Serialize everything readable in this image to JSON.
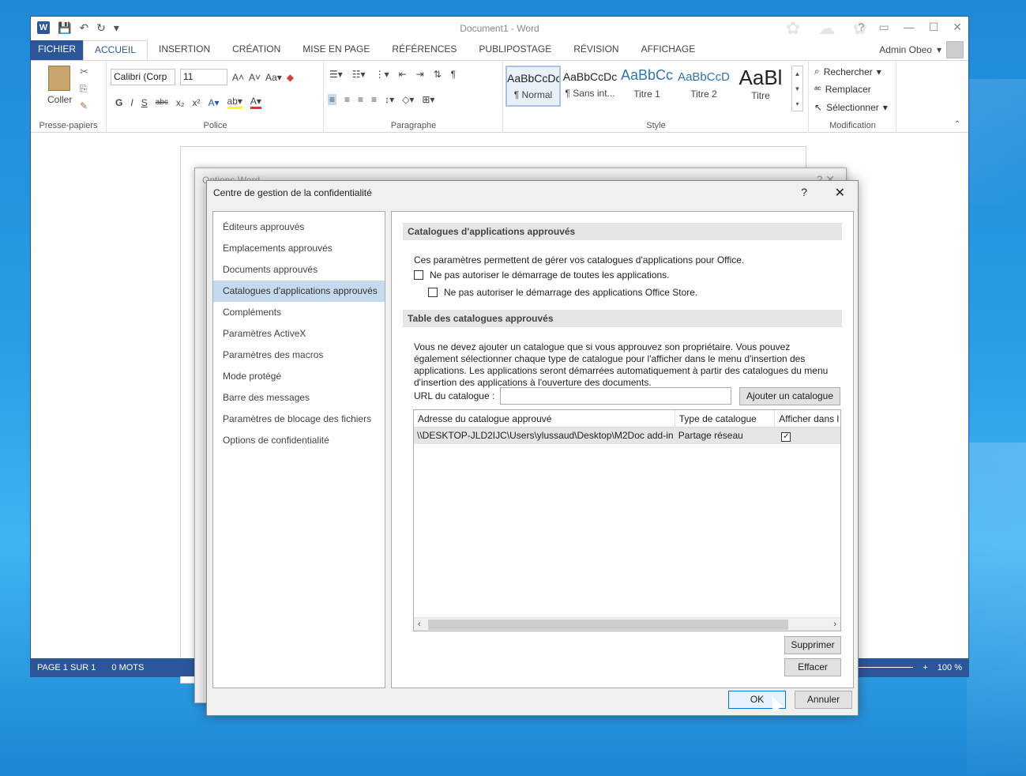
{
  "word": {
    "title": "Document1 - Word",
    "qat_icons": [
      "word-logo-icon",
      "save-icon",
      "undo-icon",
      "redo-icon",
      "customize-icon"
    ],
    "logo_letter": "W",
    "window_controls": [
      "?",
      "▭",
      "—",
      "☐",
      "✕"
    ],
    "tabs": [
      "FICHIER",
      "ACCUEIL",
      "INSERTION",
      "CRÉATION",
      "MISE EN PAGE",
      "RÉFÉRENCES",
      "PUBLIPOSTAGE",
      "RÉVISION",
      "AFFICHAGE"
    ],
    "active_tab": "ACCUEIL",
    "user": "Admin Obeo",
    "ribbon": {
      "clipboard": {
        "paste_label": "Coller",
        "group_label": "Presse-papiers"
      },
      "font": {
        "name": "Calibri (Corp",
        "size": "11",
        "group_label": "Police",
        "buttons": [
          "G",
          "I",
          "S",
          "abc",
          "x₂",
          "x²"
        ]
      },
      "paragraph": {
        "group_label": "Paragraphe"
      },
      "styles": {
        "group_label": "Style",
        "items": [
          {
            "sample": "AaBbCcDc",
            "name": "¶ Normal"
          },
          {
            "sample": "AaBbCcDc",
            "name": "¶ Sans int..."
          },
          {
            "sample": "AaBbCc",
            "name": "Titre 1"
          },
          {
            "sample": "AaBbCcD",
            "name": "Titre 2"
          },
          {
            "sample": "AaBl",
            "name": "Titre"
          }
        ]
      },
      "editing": {
        "group_label": "Modification",
        "find": "Rechercher",
        "replace": "Remplacer",
        "select": "Sélectionner"
      }
    },
    "status": {
      "page": "PAGE 1 SUR 1",
      "words": "0 MOTS",
      "zoom": "100 %"
    }
  },
  "options_back_title": "Options Word",
  "dialog": {
    "title": "Centre de gestion de la confidentialité",
    "help": "?",
    "close": "✕",
    "nav": [
      "Éditeurs approuvés",
      "Emplacements approuvés",
      "Documents approuvés",
      "Catalogues d'applications approuvés",
      "Compléments",
      "Paramètres ActiveX",
      "Paramètres des macros",
      "Mode protégé",
      "Barre des messages",
      "Paramètres de blocage des fichiers",
      "Options de confidentialité"
    ],
    "selected_nav": "Catalogues d'applications approuvés",
    "section1_title": "Catalogues d'applications approuvés",
    "section1_desc": "Ces paramètres permettent de gérer vos catalogues d'applications pour Office.",
    "check1": "Ne pas autoriser le démarrage de toutes les applications.",
    "check2": "Ne pas autoriser le démarrage des applications Office Store.",
    "section2_title": "Table des catalogues approuvés",
    "section2_desc": "Vous ne devez ajouter un catalogue que si vous approuvez son propriétaire. Vous pouvez également sélectionner chaque type de catalogue pour l'afficher dans le menu d'insertion des applications. Les applications seront démarrées automatiquement à partir des catalogues du menu d'insertion des applications à l'ouverture des documents.",
    "url_label": "URL du catalogue :",
    "url_value": "",
    "add_button": "Ajouter un catalogue",
    "table": {
      "columns": [
        "Adresse du catalogue approuvé",
        "Type de catalogue",
        "Afficher dans l"
      ],
      "rows": [
        {
          "address": "\\\\DESKTOP-JLD2IJC\\Users\\ylussaud\\Desktop\\M2Doc add-in",
          "type": "Partage réseau",
          "show": "✓"
        }
      ]
    },
    "remove_button": "Supprimer",
    "clear_button": "Effacer",
    "ok_button": "OK",
    "cancel_button": "Annuler"
  }
}
